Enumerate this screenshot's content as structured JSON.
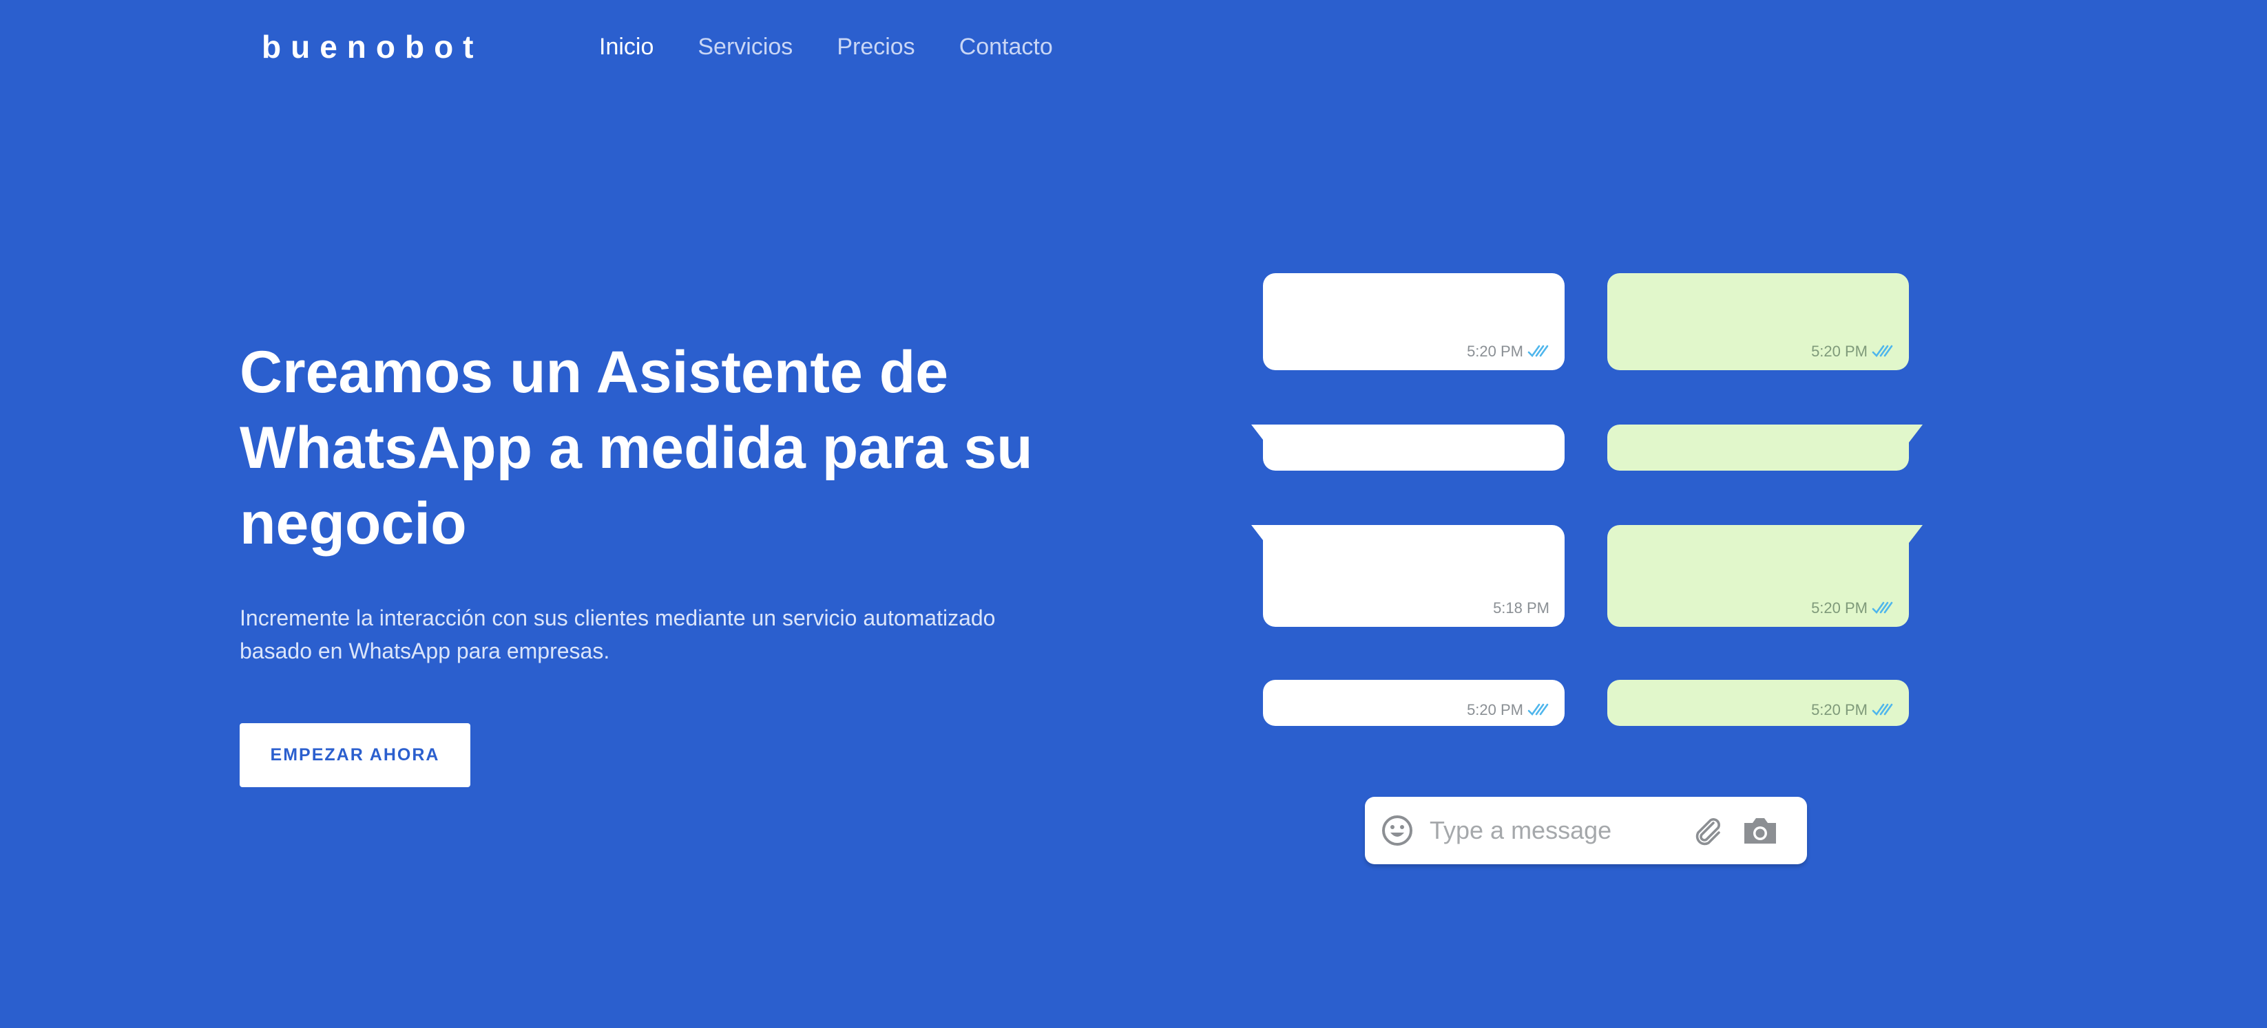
{
  "brand": {
    "logo_text": "buenobot"
  },
  "nav": {
    "items": [
      {
        "label": "Inicio",
        "active": true
      },
      {
        "label": "Servicios",
        "active": false
      },
      {
        "label": "Precios",
        "active": false
      },
      {
        "label": "Contacto",
        "active": false
      }
    ]
  },
  "hero": {
    "title_line1": "Creamos un Asistente de",
    "title_line2": "WhatsApp a medida para su",
    "title_line3": "negocio",
    "subtitle_line1": "Incremente la interacción con sus clientes mediante un servicio automatizado",
    "subtitle_line2": "basado en WhatsApp para empresas.",
    "cta_label": "EMPEZAR AHORA"
  },
  "chat": {
    "messages": [
      {
        "direction": "in",
        "time": "5:20 PM",
        "read": true
      },
      {
        "direction": "out",
        "time": "5:20 PM",
        "read": true
      },
      {
        "direction": "in",
        "time": "",
        "read": false
      },
      {
        "direction": "out",
        "time": "",
        "read": false
      },
      {
        "direction": "in",
        "time": "5:18 PM",
        "read": false
      },
      {
        "direction": "out",
        "time": "5:20 PM",
        "read": true
      },
      {
        "direction": "in",
        "time": "5:20 PM",
        "read": true
      },
      {
        "direction": "out",
        "time": "5:20 PM",
        "read": true
      }
    ],
    "composer": {
      "placeholder": "Type a message",
      "value": "",
      "icons": [
        "emoji-icon",
        "paperclip-icon",
        "camera-icon"
      ]
    }
  },
  "colors": {
    "background": "#2b5fce",
    "incoming_bubble": "#ffffff",
    "outgoing_bubble": "#e1f7cb",
    "read_ticks": "#4fb6ec",
    "icon_gray": "#8c8f93"
  }
}
